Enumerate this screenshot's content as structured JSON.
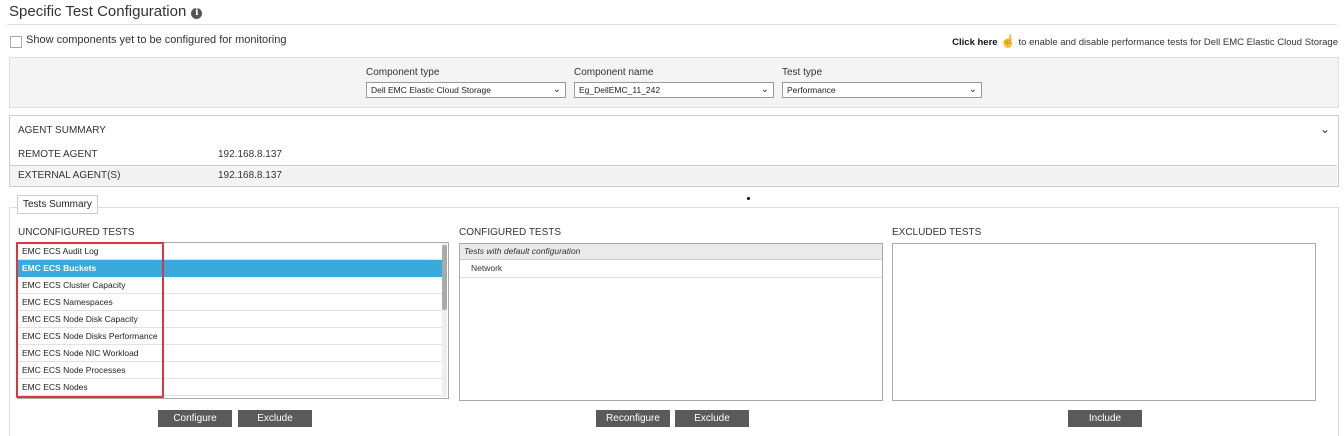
{
  "page": {
    "title": "Specific Test Configuration",
    "info_icon": "i"
  },
  "show_components": {
    "label": "Show components yet to be configured for monitoring",
    "checked": false
  },
  "click_here": {
    "link": "Click here",
    "text": "to enable and disable performance tests for Dell EMC Elastic Cloud Storage"
  },
  "filters": {
    "component_type": {
      "label": "Component type",
      "value": "Dell EMC Elastic Cloud Storage"
    },
    "component_name": {
      "label": "Component name",
      "value": "Eg_DellEMC_11_242"
    },
    "test_type": {
      "label": "Test type",
      "value": "Performance"
    }
  },
  "agent_summary": {
    "heading": "AGENT SUMMARY",
    "remote_label": "REMOTE AGENT",
    "remote_value": "192.168.8.137",
    "external_label": "EXTERNAL AGENT(S)",
    "external_value": "192.168.8.137"
  },
  "tests_summary": {
    "tab_label": "Tests Summary",
    "unconfigured": {
      "heading": "UNCONFIGURED TESTS",
      "items": [
        "EMC ECS Audit Log",
        "EMC ECS Buckets",
        "EMC ECS Cluster Capacity",
        "EMC ECS Namespaces",
        "EMC ECS Node Disk Capacity",
        "EMC ECS Node Disks Performance",
        "EMC ECS Node NIC Workload",
        "EMC ECS Node Processes",
        "EMC ECS Nodes"
      ],
      "selected": "EMC ECS Buckets"
    },
    "configured": {
      "heading": "CONFIGURED TESTS",
      "group_heading": "Tests with default configuration",
      "items": [
        "Network"
      ]
    },
    "excluded": {
      "heading": "EXCLUDED TESTS"
    }
  },
  "buttons": {
    "configure": "Configure",
    "exclude1": "Exclude",
    "reconfigure": "Reconfigure",
    "exclude2": "Exclude",
    "include": "Include"
  },
  "icons": {
    "info": "info-icon",
    "hand": "hand-pointer-icon",
    "chevron": "chevron-down-icon",
    "collapse": "chevron-down-icon"
  },
  "colors": {
    "selected": "#3aa9db",
    "highlight_box": "#d9363e",
    "button": "#5a5a5a"
  }
}
